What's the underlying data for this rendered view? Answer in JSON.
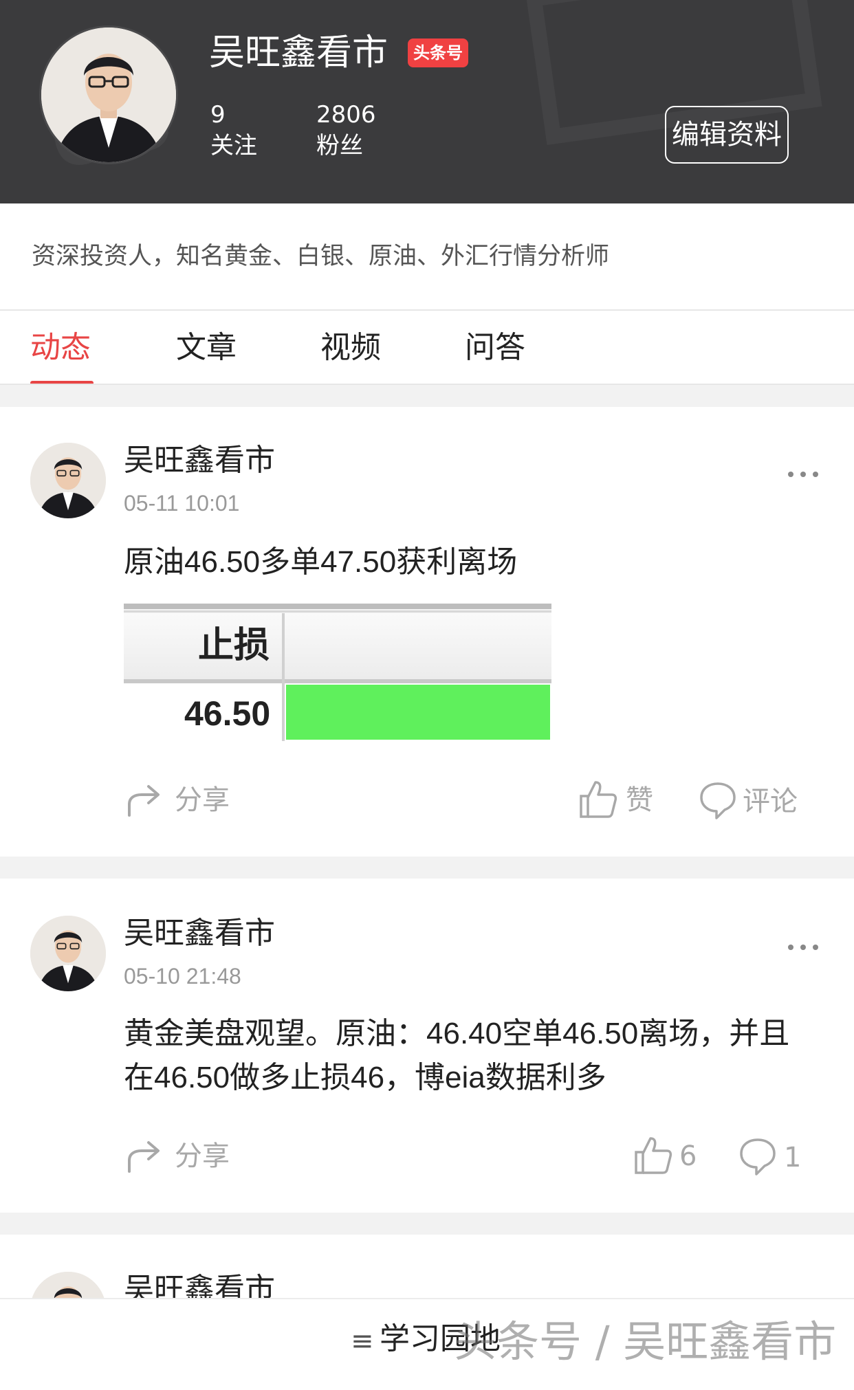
{
  "profile": {
    "name": "吴旺鑫看市",
    "badge": "头条号",
    "following_count": "9",
    "following_label": "关注",
    "fans_count": "2806",
    "fans_label": "粉丝",
    "edit_button": "编辑资料",
    "bio": "资深投资人，知名黄金、白银、原油、外汇行情分析师"
  },
  "tabs": [
    {
      "label": "动态",
      "active": true
    },
    {
      "label": "文章",
      "active": false
    },
    {
      "label": "视频",
      "active": false
    },
    {
      "label": "问答",
      "active": false
    }
  ],
  "posts": [
    {
      "author": "吴旺鑫看市",
      "time": "05-11 10:01",
      "text": "原油46.50多单47.50获利离场",
      "image": {
        "header_label": "止损",
        "value": "46.50"
      },
      "share_label": "分享",
      "like_label": "赞",
      "comment_label": "评论"
    },
    {
      "author": "吴旺鑫看市",
      "time": "05-10 21:48",
      "text": "黄金美盘观望。原油：46.40空单46.50离场，并且在46.50做多止损46，博eia数据利多",
      "share_label": "分享",
      "like_label": "6",
      "comment_label": "1"
    },
    {
      "author": "吴旺鑫看市"
    }
  ],
  "footer": {
    "menu_label": "学习园地",
    "watermark": "头条号 / 吴旺鑫看市"
  },
  "colors": {
    "header_bg": "#3b3b3d",
    "accent": "#e84545",
    "badge": "#f04142"
  }
}
